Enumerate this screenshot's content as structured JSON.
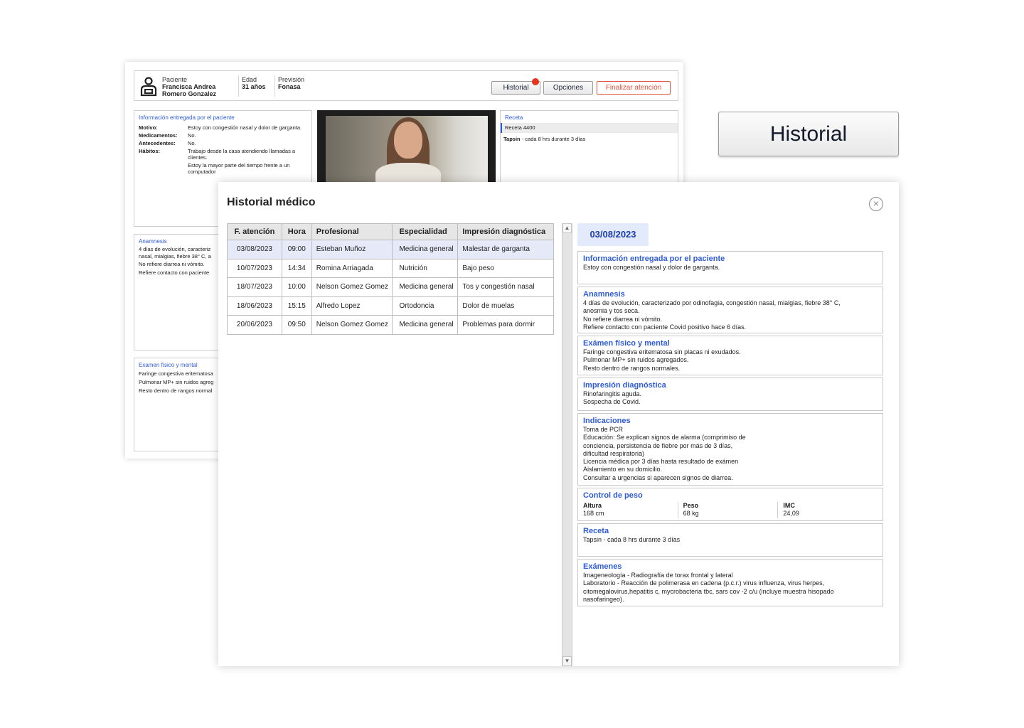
{
  "patient": {
    "label": "Paciente",
    "first_name": "Francisca Andrea",
    "last_name": "Romero Gonzalez",
    "age_label": "Edad",
    "age": "31 años",
    "insurance_label": "Previsión",
    "insurance": "Fonasa"
  },
  "header_buttons": {
    "historial": "Historial",
    "opciones": "Opciones",
    "finalizar": "Finalizar atención"
  },
  "patient_info": {
    "title": "Información entregada por el paciente",
    "rows": [
      {
        "key": "Motivo:",
        "value": "Estoy con congestión nasal y dolor de garganta."
      },
      {
        "key": "Medicamentos:",
        "value": "No."
      },
      {
        "key": "Antecedentes:",
        "value": "No."
      },
      {
        "key": "Hábitos:",
        "value": "Trabajo desde la casa atendiendo llamadas a clientes."
      },
      {
        "key": "",
        "value": "Estoy la mayor parte del tiempo frente a un computador"
      }
    ]
  },
  "anamnesis_bg": {
    "title": "Anamnesis",
    "lines": [
      "4 días de evolución, caracteriz",
      "nasal, mialgias, fiebre 38° C, a",
      "No refiere diarrea ni vómito.",
      "Refiere contacto con paciente"
    ]
  },
  "examen_bg": {
    "title": "Examen físico y mental",
    "lines": [
      "Faringe congestiva eritematosa",
      "Pulmonar MP+ sin ruidos agreg",
      "Resto dentro de rangos normal"
    ]
  },
  "receta_bg": {
    "title": "Receta",
    "selected": "Receta 4400",
    "item_name": "Tapsin",
    "item_detail": " - cada 8 hrs durante 3 días"
  },
  "floating_button": "Historial",
  "modal": {
    "title": "Historial médico",
    "columns": [
      "F. atención",
      "Hora",
      "Profesional",
      "Especialidad",
      "Impresión diagnóstica"
    ],
    "rows": [
      [
        "03/08/2023",
        "09:00",
        "Esteban Muñoz",
        "Medicina general",
        "Malestar de garganta"
      ],
      [
        "10/07/2023",
        "14:34",
        "Romina Arriagada",
        "Nutrición",
        "Bajo peso"
      ],
      [
        "18/07/2023",
        "10:00",
        "Nelson Gomez Gomez",
        "Medicina general",
        "Tos y congestión nasal"
      ],
      [
        "18/06/2023",
        "15:15",
        "Alfredo Lopez",
        "Ortodoncia",
        "Dolor de muelas"
      ],
      [
        "20/06/2023",
        "09:50",
        "Nelson Gomez Gomez",
        "Medicina general",
        "Problemas para dormir"
      ]
    ],
    "selected_date": "03/08/2023",
    "detail": {
      "info": {
        "title": "Información entregada por el paciente",
        "lines": [
          "Estoy con congestión nasal y dolor de garganta."
        ]
      },
      "anamnesis": {
        "title": "Anamnesis",
        "lines": [
          "4 días de evolución, caracterizado por odinofagia, congestión nasal, mialgias, fiebre 38° C,",
          "anosmia y tos seca.",
          "No refiere diarrea ni vómito.",
          "Refiere contacto con paciente Covid positivo hace 6 días."
        ]
      },
      "examen": {
        "title": "Exámen físico y mental",
        "lines": [
          "Faringe congestiva eritematosa sin placas ni exudados.",
          "Pulmonar MP+ sin ruidos agregados.",
          "Resto dentro de rangos normales."
        ]
      },
      "impresion": {
        "title": "Impresión diagnóstica",
        "lines": [
          "Rinofaringitis aguda.",
          "Sospecha de Covid."
        ]
      },
      "indicaciones": {
        "title": "Indicaciones",
        "lines": [
          "Toma de PCR",
          "Educación: Se explican signos de alarma (comprimiso de",
          "conciencia, persistencia de fiebre por más de 3 días,",
          "dificultad respiratoria)",
          "Licencia médica por 3 días hasta resultado de exámen",
          "Aislamiento en su domicilio.",
          "Consultar a urgencias si aparecen signos de diarrea."
        ]
      },
      "peso": {
        "title": "Control de peso",
        "altura_label": "Altura",
        "altura": "168 cm",
        "peso_label": "Peso",
        "peso": "68 kg",
        "imc_label": "IMC",
        "imc": "24,09"
      },
      "receta": {
        "title": "Receta",
        "lines": [
          "Tapsin - cada 8 hrs durante 3 días"
        ]
      },
      "examenes": {
        "title": "Exámenes",
        "lines": [
          "Imageneología - Radiografía de torax frontal y lateral",
          "Laboratorio - Reacción de polimerasa en cadena (p.c.r.) virus influenza, virus herpes,",
          "citomegalovirus,hepatitis c, mycrobacteria tbc, sars cov -2 c/u (incluye muestra hisopado",
          "nasofaringeo)."
        ]
      }
    }
  },
  "icons": {
    "avatar": "user-icon",
    "close": "close-circle-icon",
    "scroll_up": "chevron-up-icon",
    "scroll_down": "chevron-down-icon"
  },
  "colors": {
    "accent_blue": "#2e5bd8",
    "danger_red": "#e0533d",
    "selected_row": "#e5e9f8"
  }
}
